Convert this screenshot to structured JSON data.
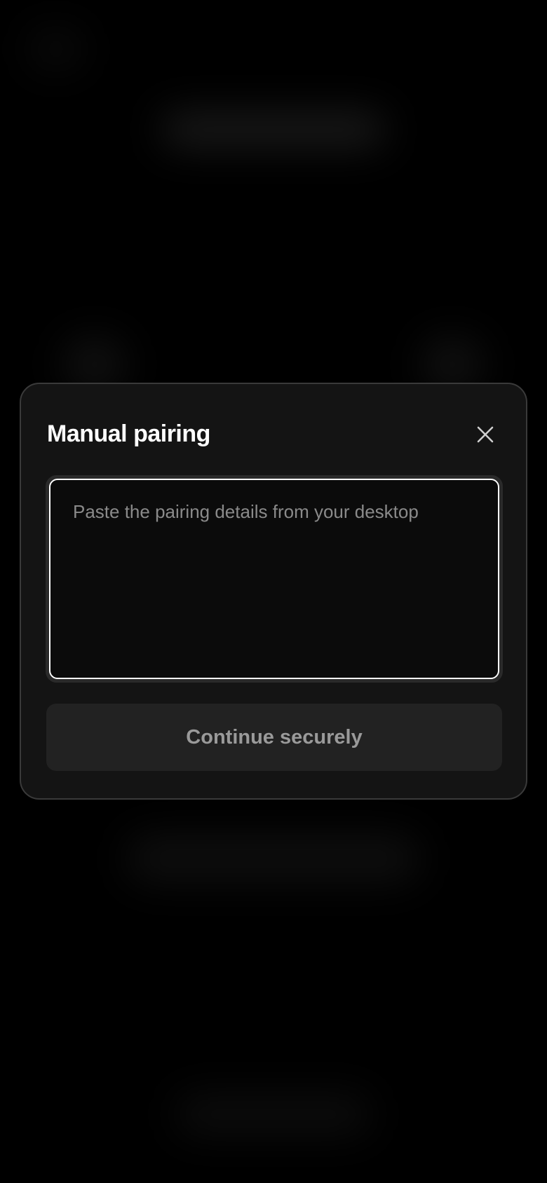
{
  "dialog": {
    "title": "Manual pairing",
    "close_icon": "close-icon",
    "input": {
      "value": "",
      "placeholder": "Paste the pairing details from your desktop"
    },
    "continue_label": "Continue securely"
  },
  "colors": {
    "background": "#000000",
    "modal_background": "#141414",
    "modal_border": "#3a3a3a",
    "input_border": "#ffffff",
    "button_background": "#222222",
    "button_text": "#9a9a9a"
  }
}
